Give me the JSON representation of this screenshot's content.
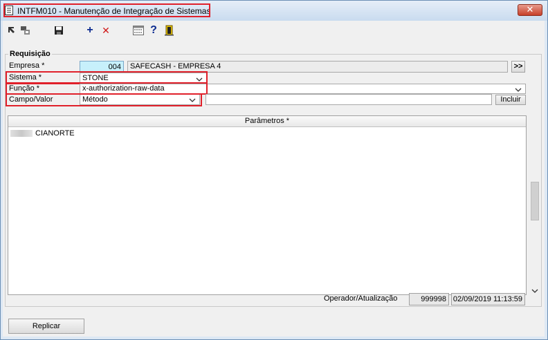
{
  "window": {
    "title": "INTFM010 - Manutenção de Integração de Sistemas",
    "close_glyph": "✕"
  },
  "toolbar": {
    "icons": [
      "first-record-icon",
      "copy-record-icon",
      "save-icon",
      "add-icon",
      "delete-icon",
      "calendar-icon",
      "help-icon",
      "exit-door-icon"
    ],
    "add_glyph": "+",
    "delete_glyph": "✕",
    "help_glyph": "?"
  },
  "form": {
    "group_title": "Requisição",
    "empresa": {
      "label": "Empresa *",
      "code": "004",
      "name": "SAFECASH -  EMPRESA 4",
      "lookup_label": ">>"
    },
    "sistema": {
      "label": "Sistema *",
      "value": "STONE"
    },
    "funcao": {
      "label": "Função *",
      "value": "x-authorization-raw-data"
    },
    "campo_valor": {
      "label": "Campo/Valor",
      "value": "Método",
      "text_value": "",
      "add_label": "Incluir"
    }
  },
  "parametros": {
    "header": "Parâmetros *",
    "rows": [
      "CIANORTE"
    ]
  },
  "status": {
    "label": "Operador/Atualização",
    "operador": "999998",
    "data": "02/09/2019 11:13:59"
  },
  "footer": {
    "replicar_label": "Replicar"
  },
  "colors": {
    "highlight": "#e0202a",
    "focus_field": "#c7f0fb",
    "title_bar": "#c9dbef"
  }
}
